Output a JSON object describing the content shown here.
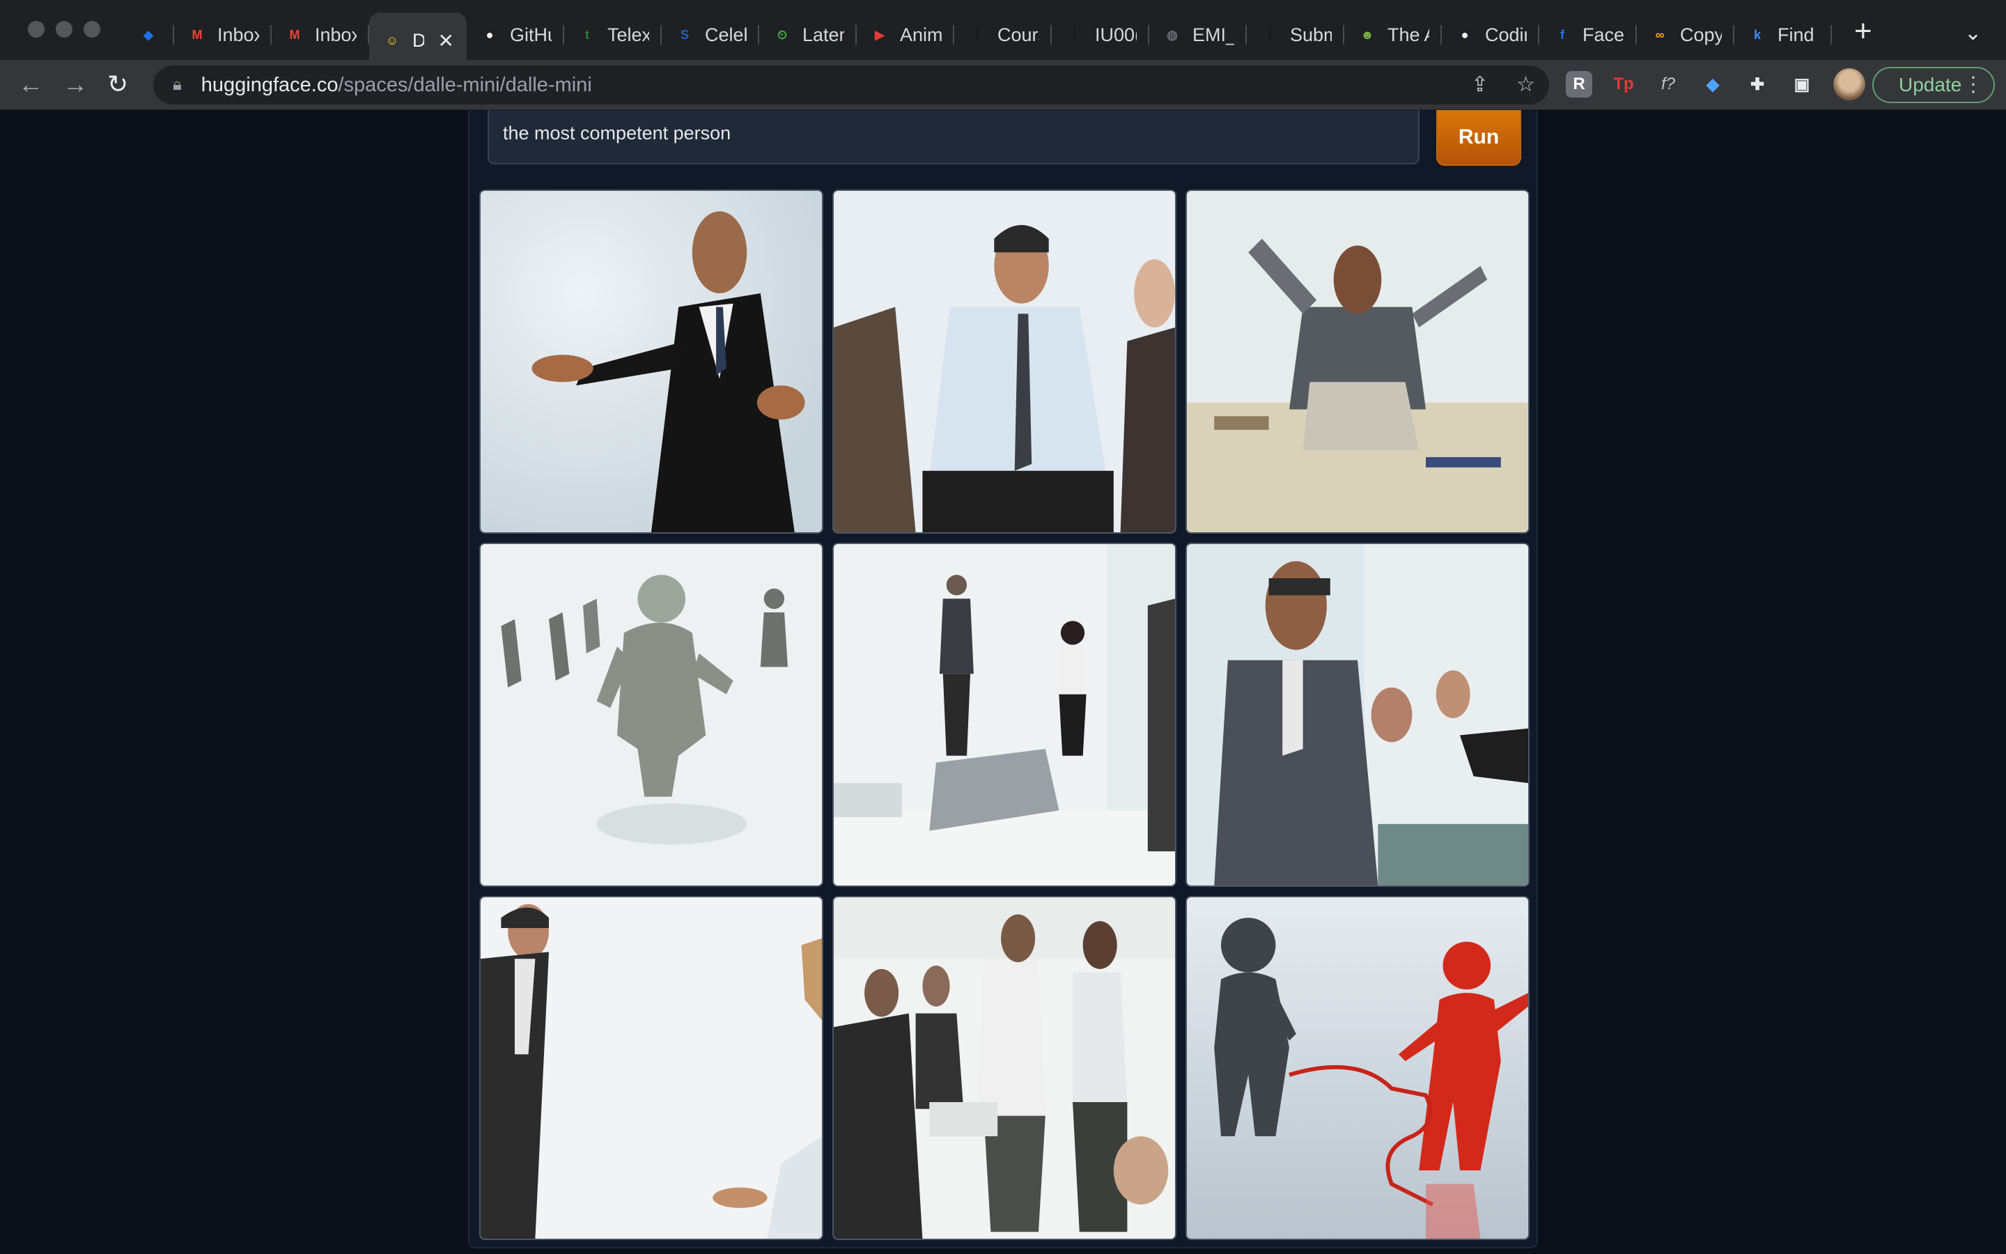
{
  "browser": {
    "tabs": [
      {
        "title": "",
        "icon": "gem-icon",
        "color": "#1a73e8",
        "active": false
      },
      {
        "title": "Inbox",
        "icon": "gmail-icon",
        "color": "#ea4335",
        "active": false
      },
      {
        "title": "Inbox",
        "icon": "gmail-icon",
        "color": "#ea4335",
        "active": false
      },
      {
        "title": "Da",
        "icon": "huggingface-icon",
        "color": "#ffd21e",
        "active": true
      },
      {
        "title": "GitHu",
        "icon": "github-icon",
        "color": "#ffffff",
        "active": false
      },
      {
        "title": "Telex",
        "icon": "telex-icon",
        "color": "#2e7d32",
        "active": false
      },
      {
        "title": "Celeb",
        "icon": "s-icon",
        "color": "#1e63c6",
        "active": false
      },
      {
        "title": "Later",
        "icon": "later-icon",
        "color": "#43a047",
        "active": false
      },
      {
        "title": "Anima",
        "icon": "youtube-icon",
        "color": "#e53935",
        "active": false
      },
      {
        "title": "Cours",
        "icon": "dots-icon",
        "color": "#111111",
        "active": false
      },
      {
        "title": "IU00(",
        "icon": "dots-icon",
        "color": "#111111",
        "active": false
      },
      {
        "title": "EMI_",
        "icon": "globe-icon",
        "color": "#6b6f75",
        "active": false
      },
      {
        "title": "Subm",
        "icon": "dots-icon",
        "color": "#111111",
        "active": false
      },
      {
        "title": "The A",
        "icon": "smiley-icon",
        "color": "#7cb342",
        "active": false
      },
      {
        "title": "Codir",
        "icon": "github-icon",
        "color": "#ffffff",
        "active": false
      },
      {
        "title": "Facel",
        "icon": "facebook-icon",
        "color": "#1877f2",
        "active": false
      },
      {
        "title": "Copy",
        "icon": "infinity-icon",
        "color": "#f9a825",
        "active": false
      },
      {
        "title": "Find",
        "icon": "k-icon",
        "color": "#3d8bfd",
        "active": false
      }
    ],
    "url_host": "huggingface.co",
    "url_path": "/spaces/dalle-mini/dalle-mini",
    "update_label": "Update"
  },
  "app": {
    "prompt_value": "the most competent person",
    "run_label": "Run",
    "images": [
      {
        "name": "gallery-image-1",
        "desc": "man in black suit gesturing"
      },
      {
        "name": "gallery-image-2",
        "desc": "man in white shirt and tie at meeting"
      },
      {
        "name": "gallery-image-3",
        "desc": "man at laptop raising arms"
      },
      {
        "name": "gallery-image-4",
        "desc": "3d figure walking ahead of small figures"
      },
      {
        "name": "gallery-image-5",
        "desc": "blurry office people with laptop"
      },
      {
        "name": "gallery-image-6",
        "desc": "man with glasses in grey suit"
      },
      {
        "name": "gallery-image-7",
        "desc": "man in suit leaning at desk"
      },
      {
        "name": "gallery-image-8",
        "desc": "group of business people"
      },
      {
        "name": "gallery-image-9",
        "desc": "grey and red 3d figures"
      }
    ]
  }
}
